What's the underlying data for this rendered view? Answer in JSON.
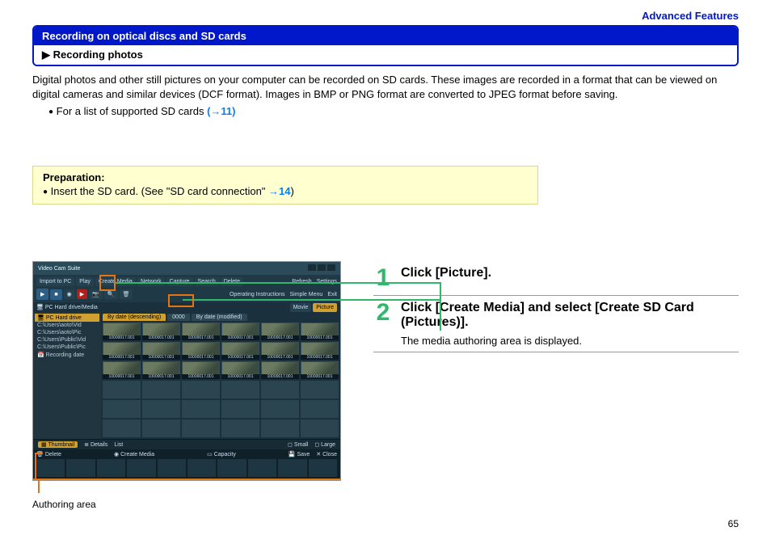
{
  "header": {
    "section_label": "Advanced Features",
    "title_bar": "Recording on optical discs and SD cards",
    "subtitle": "▶ Recording photos"
  },
  "intro": {
    "paragraph": "Digital photos and other still pictures on your computer can be recorded on SD cards. These images are recorded in a format that can be viewed on digital cameras and similar devices (DCF format). Images in BMP or PNG format are converted to JPEG format before saving.",
    "bullet_text": "For a list of supported SD cards ",
    "bullet_link": "(→11)"
  },
  "preparation": {
    "title": "Preparation:",
    "text": "Insert the SD card. (See \"SD card connection\" ",
    "link": "→14",
    "text_after": ")"
  },
  "screenshot": {
    "app_title": "Video Cam Suite",
    "toolbar": {
      "items": [
        "Import to PC",
        "Play",
        "Create Media",
        "Network",
        "Capture",
        "Search",
        "Delete"
      ],
      "right": [
        "Refresh",
        "Settings",
        "Operating Instructions",
        "Simple Menu",
        "Exit"
      ]
    },
    "subbar_left": "PC Hard drive/Media",
    "subbar_right_tabs": [
      "Movie",
      "Picture"
    ],
    "sidebar": {
      "head": "PC Hard drive",
      "items": [
        "C:\\Users\\aoto\\Vid",
        "C:\\Users\\aoto\\Pic",
        "C:\\Users\\Public\\Vid",
        "C:\\Users\\Public\\Pic",
        "Recording date"
      ]
    },
    "view_tabs": [
      "By date (descending)",
      "0000",
      "By date (modified)"
    ],
    "thumb_caption": "10000017.001",
    "bottom_bar": {
      "items": [
        "Thumbnail",
        "Details",
        "List",
        "Small",
        "Large"
      ]
    },
    "tray": {
      "items": [
        "Delete",
        "Create Media",
        "Capacity",
        "Save",
        "Close"
      ]
    },
    "authoring_caption": "Authoring area"
  },
  "steps": [
    {
      "num": "1",
      "title": "Click [Picture]."
    },
    {
      "num": "2",
      "title": "Click [Create Media] and select [Create SD Card (Pictures)].",
      "desc": "The media authoring area is displayed."
    }
  ],
  "page_number": "65"
}
